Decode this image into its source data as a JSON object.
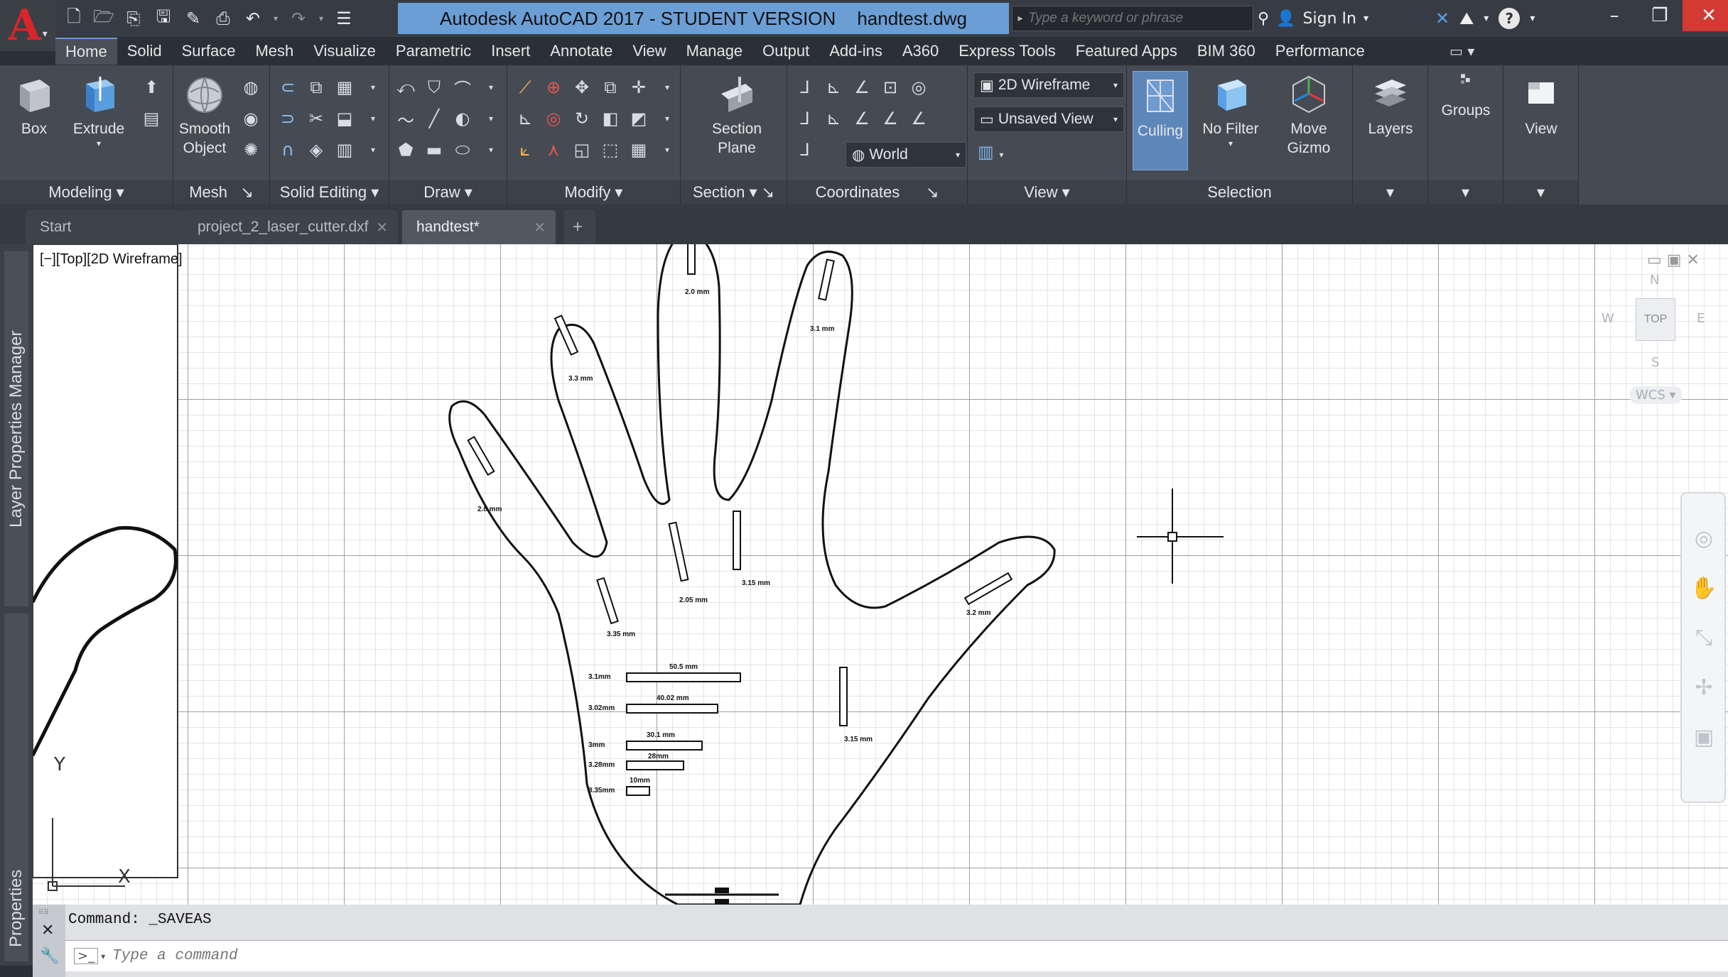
{
  "titlebar": {
    "app_title": "Autodesk AutoCAD 2017 - STUDENT VERSION",
    "file_name": "handtest.dwg",
    "search_placeholder": "Type a keyword or phrase",
    "sign_in": "Sign In"
  },
  "ribbon_tabs": [
    "Home",
    "Solid",
    "Surface",
    "Mesh",
    "Visualize",
    "Parametric",
    "Insert",
    "Annotate",
    "View",
    "Manage",
    "Output",
    "Add-ins",
    "A360",
    "Express Tools",
    "Featured Apps",
    "BIM 360",
    "Performance"
  ],
  "ribbon": {
    "box": "Box",
    "extrude": "Extrude",
    "smooth_object": "Smooth Object",
    "section_plane": "Section Plane",
    "culling": "Culling",
    "no_filter": "No Filter",
    "move_gizmo": "Move Gizmo",
    "layers": "Layers",
    "groups": "Groups",
    "view": "View",
    "visual_style": "2D Wireframe",
    "named_view": "Unsaved View",
    "ucs": "World",
    "panels": {
      "modeling": "Modeling",
      "mesh": "Mesh",
      "solid_editing": "Solid Editing",
      "draw": "Draw",
      "modify": "Modify",
      "section": "Section",
      "coordinates": "Coordinates",
      "view": "View",
      "selection": "Selection"
    }
  },
  "doc_tabs": [
    "Start",
    "project_2_laser_cutter.dxf",
    "handtest*"
  ],
  "palettes": {
    "layer_properties": "Layer Properties Manager",
    "properties": "Properties"
  },
  "viewport": {
    "label": "[−][Top][2D Wireframe]",
    "viewcube_top": "TOP",
    "viewcube_n": "N",
    "viewcube_s": "S",
    "viewcube_w": "W",
    "viewcube_e": "E",
    "wcs": "WCS",
    "ucs_x": "X",
    "ucs_y": "Y"
  },
  "drawing_labels": {
    "thumb": "2.8 mm",
    "index": "3.3 mm",
    "middle": "2.0 mm",
    "ring": "3.1 mm",
    "pinky": "3.2 mm",
    "base_1": "3.35 mm",
    "base_2": "2.05 mm",
    "base_3": "3.15 mm",
    "base_4": "3.15 mm",
    "bar_labels": [
      "3.1mm",
      "3.02mm",
      "3mm",
      "3.28mm",
      "3.35mm"
    ],
    "bar_values": [
      "50.5 mm",
      "40.02 mm",
      "30.1 mm",
      "28mm",
      "10mm"
    ]
  },
  "command": {
    "history": "Command:  _SAVEAS",
    "placeholder": "Type a command"
  },
  "colors": {
    "accent": "#6c9ed6",
    "close": "#d23a33",
    "logo": "#d8252c"
  }
}
